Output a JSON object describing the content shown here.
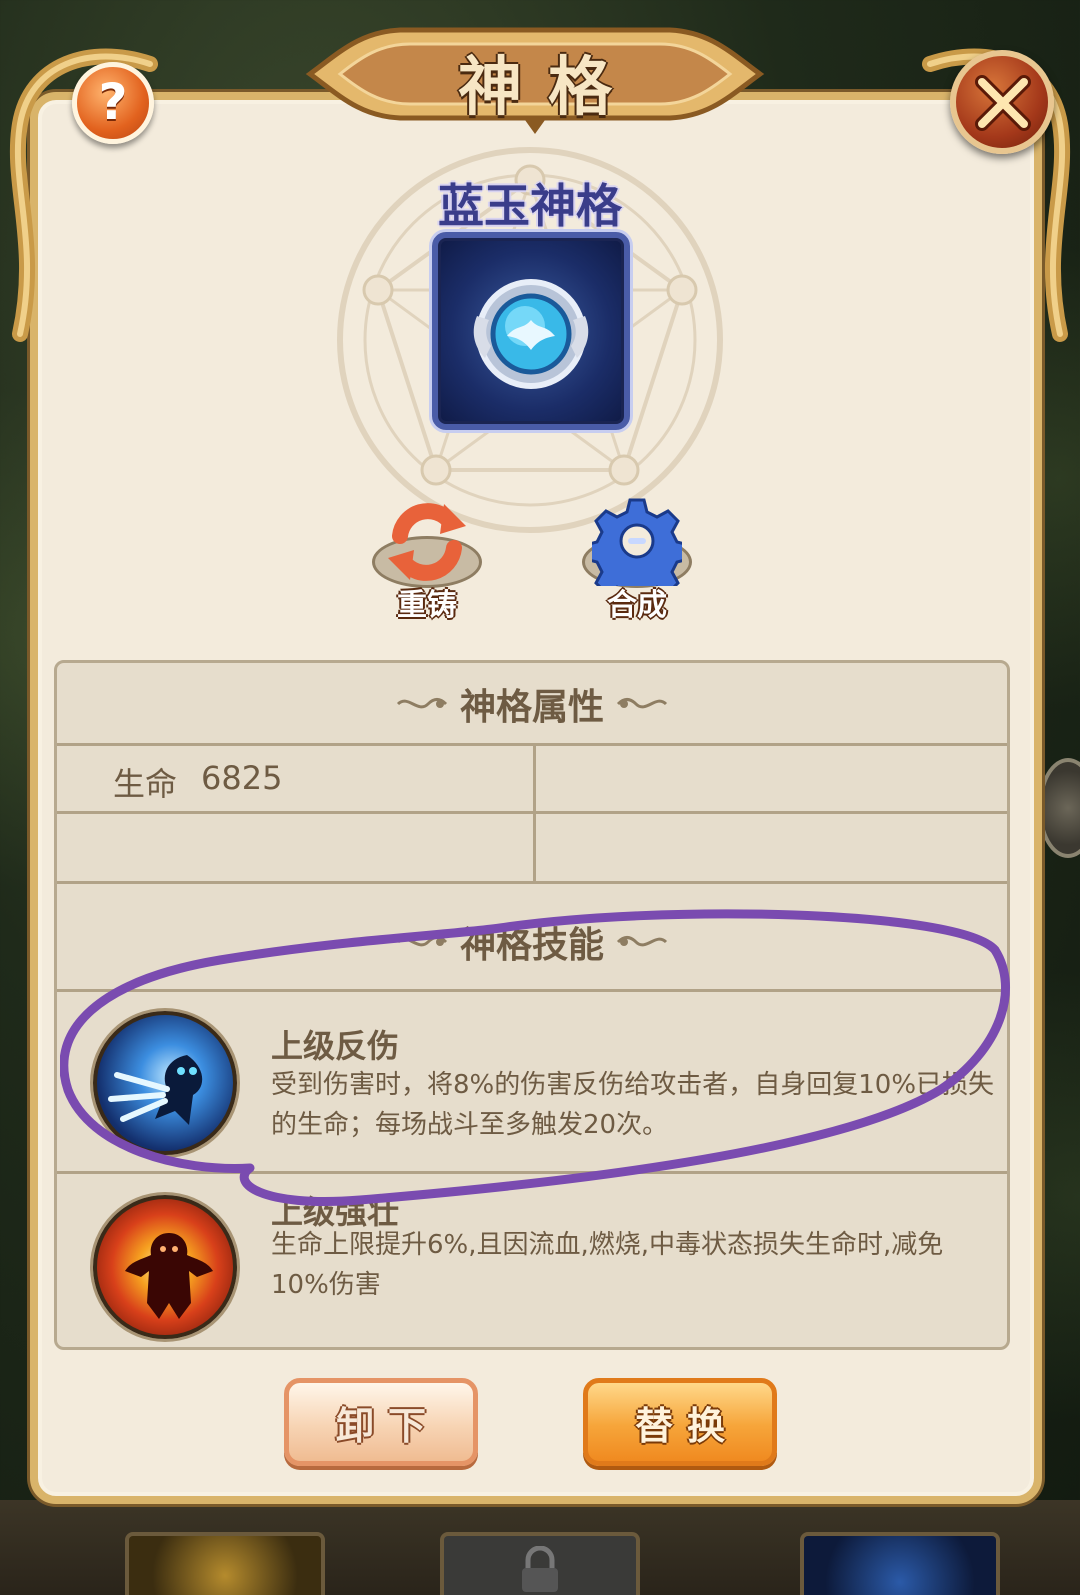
{
  "dialog": {
    "title": "神格",
    "help_icon": "question-mark-icon",
    "close_icon": "close-x-icon"
  },
  "item": {
    "name": "蓝玉神格",
    "icon": "blue-jade-emblem-icon"
  },
  "actions": {
    "reforge_label": "重铸",
    "combine_label": "合成"
  },
  "attributes": {
    "header": "神格属性",
    "rows": [
      {
        "name": "生命",
        "value": "6825"
      }
    ]
  },
  "skills": {
    "header": "神格技能",
    "items": [
      {
        "name": "上级反伤",
        "description": "受到伤害时，将8%的伤害反伤给攻击者，自身回复10%已损失的生命；每场战斗至多触发20次。",
        "icon": "reflect-damage-skill-icon"
      },
      {
        "name": "上级强壮",
        "description": "生命上限提升6%,且因流血,燃烧,中毒状态损失生命时,减免10%伤害",
        "icon": "strength-skill-icon"
      }
    ]
  },
  "buttons": {
    "unequip_label": "卸下",
    "replace_label": "替换"
  },
  "colors": {
    "panel_bg": "#f3ebdc",
    "frame_gold": "#d9b46a",
    "annotation_purple": "#7a4bb0",
    "replace_orange": "#f6a53a",
    "text_brown": "#6e5b43"
  }
}
